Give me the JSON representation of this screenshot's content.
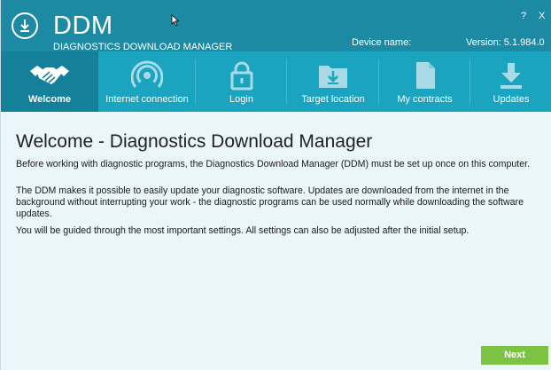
{
  "app": {
    "name": "DDM",
    "subtitle": "DIAGNOSTICS DOWNLOAD MANAGER",
    "device_label": "Device name:",
    "version_label": "Version: 5.1.984.0",
    "help_label": "?",
    "close_label": "X"
  },
  "tabs": [
    {
      "label": "Welcome",
      "icon": "handshake-icon",
      "active": true
    },
    {
      "label": "Internet connection",
      "icon": "wireless-icon",
      "active": false
    },
    {
      "label": "Login",
      "icon": "lock-icon",
      "active": false
    },
    {
      "label": "Target location",
      "icon": "folder-download-icon",
      "active": false
    },
    {
      "label": "My contracts",
      "icon": "document-icon",
      "active": false
    },
    {
      "label": "Updates",
      "icon": "download-icon",
      "active": false
    }
  ],
  "main": {
    "title": "Welcome - Diagnostics Download Manager",
    "paragraphs": [
      "Before working with diagnostic programs, the Diagnostics Download Manager (DDM) must be set up once on this computer.",
      "The DDM makes it possible to easily update your diagnostic software. Updates are downloaded from the internet in the background without interrupting your work - the diagnostic programs can be used normally while downloading the software updates.",
      "You will be guided through the most important settings. All settings can also be adjusted after the initial setup."
    ],
    "next_label": "Next"
  },
  "colors": {
    "header": "#1d8aa3",
    "tab_bar": "#1aa4c0",
    "tab_active": "#14809a",
    "content_bg": "#eaf6fa",
    "next_button": "#7cc243"
  }
}
